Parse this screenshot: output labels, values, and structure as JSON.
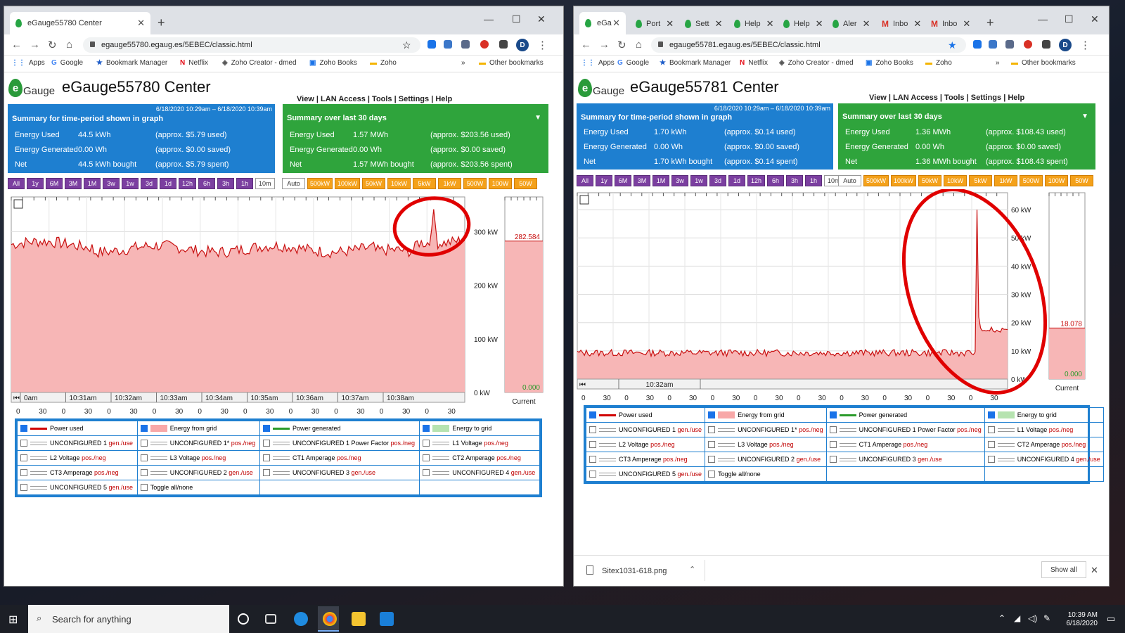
{
  "browser_left": {
    "tab": "eGauge55780 Center",
    "url": "egauge55780.egaug.es/5EBEC/classic.html"
  },
  "browser_right": {
    "tabs": [
      "eGa",
      "Port",
      "Sett",
      "Help",
      "Help",
      "Aler",
      "Inbo",
      "Inbo"
    ],
    "url": "egauge55781.egaug.es/5EBEC/classic.html",
    "download_file": "Sitex1031-618.png",
    "show_all": "Show all"
  },
  "bookmarks": {
    "apps": "Apps",
    "google": "Google",
    "bm_manager": "Bookmark Manager",
    "netflix": "Netflix",
    "zoho_creator": "Zoho Creator - dmed",
    "zoho_books": "Zoho Books",
    "zoho": "Zoho",
    "other": "Other bookmarks",
    "more": "»"
  },
  "menu": "View | LAN Access | Tools | Settings | Help",
  "logo_text": "Gauge",
  "time_buttons": [
    "All",
    "1y",
    "6M",
    "3M",
    "1M",
    "3w",
    "1w",
    "3d",
    "1d",
    "12h",
    "6h",
    "3h",
    "1h",
    "10m"
  ],
  "scale_buttons": [
    "Auto",
    "500kW",
    "100kW",
    "50kW",
    "10kW",
    "5kW",
    "1kW",
    "500W",
    "100W",
    "50W"
  ],
  "summary_labels": {
    "period": "Summary for time-period shown in graph",
    "month": "Summary over last 30 days",
    "used": "Energy Used",
    "gen": "Energy Generated",
    "net": "Net"
  },
  "left": {
    "title": "eGauge55780 Center",
    "date_range": "6/18/2020 10:29am – 6/18/2020 10:39am",
    "period": {
      "used": "44.5 kWh",
      "used_cost": "(approx. $5.79 used)",
      "gen": "0.00 Wh",
      "gen_cost": "(approx. $0.00 saved)",
      "net": "44.5 kWh bought",
      "net_cost": "(approx. $5.79 spent)"
    },
    "month": {
      "used": "1.57 MWh",
      "used_cost": "(approx. $203.56 used)",
      "gen": "0.00 Wh",
      "gen_cost": "(approx. $0.00 saved)",
      "net": "1.57 MWh bought",
      "net_cost": "(approx. $203.56 spent)"
    },
    "current_label": "Current",
    "current_value": "282.584",
    "current_zero": "0.000",
    "time_labels": [
      "0am",
      "10:31am",
      "10:32am",
      "10:33am",
      "10:34am",
      "10:35am",
      "10:36am",
      "10:37am",
      "10:38am"
    ],
    "sec_labels": [
      "0",
      "30",
      "0",
      "30",
      "0",
      "30",
      "0",
      "30",
      "0",
      "30",
      "0",
      "30",
      "0",
      "30",
      "0",
      "30",
      "0",
      "30",
      "0",
      "30"
    ],
    "y_ticks": [
      "0 kW",
      "100 kW",
      "200 kW",
      "300 kW"
    ]
  },
  "right": {
    "title": "eGauge55781 Center",
    "date_range": "6/18/2020 10:29am – 6/18/2020 10:39am",
    "period": {
      "used": "1.70 kWh",
      "used_cost": "(approx. $0.14 used)",
      "gen": "0.00 Wh",
      "gen_cost": "(approx. $0.00 saved)",
      "net": "1.70 kWh bought",
      "net_cost": "(approx. $0.14 spent)"
    },
    "month": {
      "used": "1.36 MWh",
      "used_cost": "(approx. $108.43 used)",
      "gen": "0.00 Wh",
      "gen_cost": "(approx. $0.00 saved)",
      "net": "1.36 MWh bought",
      "net_cost": "(approx. $108.43 spent)"
    },
    "current_label": "Current",
    "current_value": "18.078",
    "current_zero": "0.000",
    "time_label": "10:32am",
    "sec_labels": [
      "0",
      "30",
      "0",
      "30",
      "0",
      "30",
      "0",
      "30",
      "0",
      "30",
      "0",
      "30",
      "0",
      "30",
      "0",
      "30",
      "0",
      "30",
      "0",
      "30"
    ],
    "y_ticks": [
      "0 kW",
      "10 kW",
      "20 kW",
      "30 kW",
      "40 kW",
      "50 kW",
      "60 kW"
    ]
  },
  "legend": {
    "power_used": "Power used",
    "energy_from_grid": "Energy from grid",
    "power_generated": "Power generated",
    "energy_to_grid": "Energy to grid",
    "unc1": "UNCONFIGURED 1",
    "unc1p": "UNCONFIGURED 1*",
    "unc1pf": "UNCONFIGURED 1 Power Factor",
    "l1": "L1 Voltage",
    "l2": "L2 Voltage",
    "l3": "L3 Voltage",
    "ct1": "CT1 Amperage",
    "ct2": "CT2 Amperage",
    "ct3": "CT3 Amperage",
    "unc2": "UNCONFIGURED 2",
    "unc3": "UNCONFIGURED 3",
    "unc4": "UNCONFIGURED 4",
    "unc5": "UNCONFIGURED 5",
    "toggle": "Toggle all/none",
    "gen_use": "gen./use",
    "pos_neg": "pos./neg"
  },
  "taskbar": {
    "search": "Search for anything",
    "time": "10:39 AM",
    "date": "6/18/2020"
  }
}
